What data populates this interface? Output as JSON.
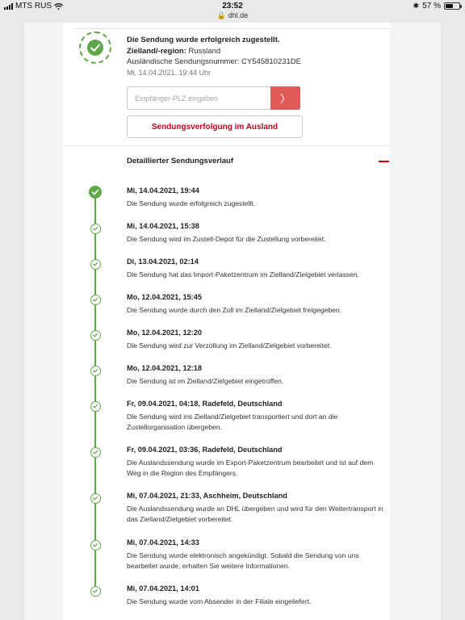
{
  "status_bar": {
    "carrier": "MTS RUS",
    "time": "23:52",
    "url": "dhl.de",
    "battery": "57 %",
    "battery_level": 0.57
  },
  "shipment": {
    "status_text": "Die Sendung wurde erfolgreich zugestellt.",
    "region_label": "Zielland/-region:",
    "region_value": "Russland",
    "foreign_number": "Ausländische Sendungsnummer: CY545810231DE",
    "datetime": "Mi, 14.04.2021, 19:44 Uhr"
  },
  "plz_form": {
    "placeholder": "Empfänger-PLZ eingeben",
    "submit_icon": "chevron-right-icon",
    "submit_glyph": "〉"
  },
  "ausland_button": "Sendungsverfolgung im Ausland",
  "history": {
    "title": "Detaillierter Sendungsverlauf",
    "events": [
      {
        "date": "Mi, 14.04.2021, 19:44",
        "text": "Die Sendung wurde erfolgreich zugestellt."
      },
      {
        "date": "Mi, 14.04.2021, 15:38",
        "text": "Die Sendung wird im Zustell-Depot für die Zustellung vorbereitet."
      },
      {
        "date": "Di, 13.04.2021, 02:14",
        "text": "Die Sendung hat das Import-Paketzentrum im Zielland/Zielgebiet verlassen."
      },
      {
        "date": "Mo, 12.04.2021, 15:45",
        "text": "Die Sendung wurde durch den Zoll im Zielland/Zielgebiet freigegeben."
      },
      {
        "date": "Mo, 12.04.2021, 12:20",
        "text": "Die Sendung wird zur Verzollung im Zielland/Zielgebiet vorbereitet."
      },
      {
        "date": "Mo, 12.04.2021, 12:18",
        "text": "Die Sendung ist im Zielland/Zielgebiet eingetroffen."
      },
      {
        "date": "Fr, 09.04.2021, 04:18, Radefeld, Deutschland",
        "text": "Die Sendung wird ins Zielland/Zielgebiet transportiert und dort an die Zustellorganisation übergeben."
      },
      {
        "date": "Fr, 09.04.2021, 03:36, Radefeld, Deutschland",
        "text": "Die Auslandssendung wurde im Export-Paketzentrum bearbeitet und ist auf dem Weg in die Region des Empfängers."
      },
      {
        "date": "Mi, 07.04.2021, 21:33, Aschheim, Deutschland",
        "text": "Die Auslandssendung wurde an DHL übergeben und wird für den Weitertransport in das Zielland/Zielgebiet vorbereitet."
      },
      {
        "date": "Mi, 07.04.2021, 14:33",
        "text": "Die Sendung wurde elektronisch angekündigt. Sobald die Sendung von uns bearbeitet wurde, erhalten Sie weitere Informationen."
      },
      {
        "date": "Mi, 07.04.2021, 14:01",
        "text": "Die Sendung wurde vom Absender in der Filiale eingeliefert."
      }
    ]
  },
  "colors": {
    "success": "#5fa84a",
    "dhl_red": "#d40511",
    "button_red": "#e05a5a"
  }
}
